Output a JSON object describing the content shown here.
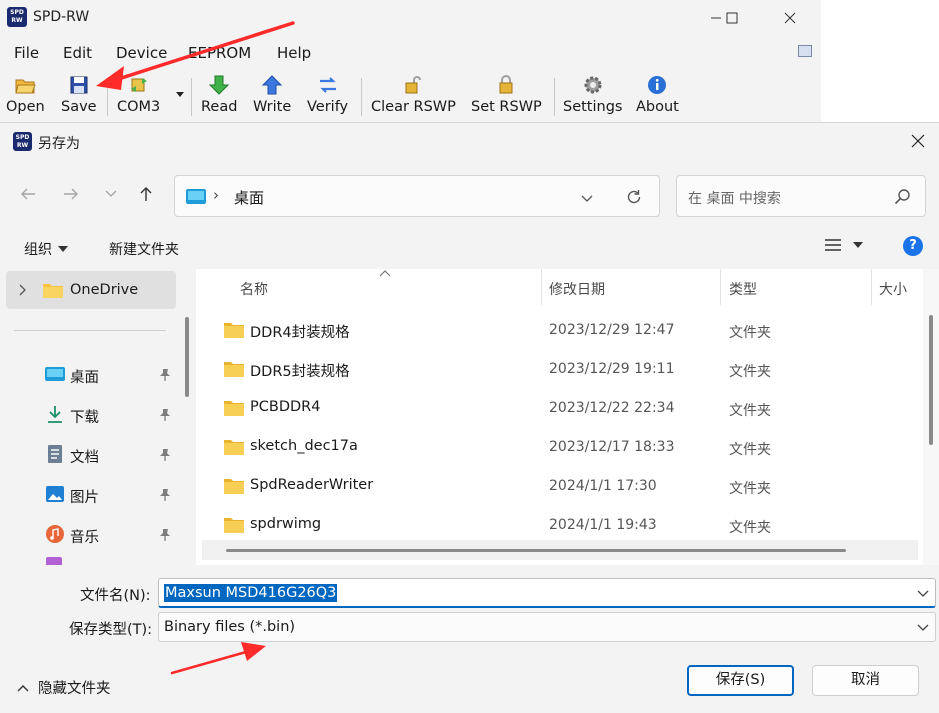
{
  "app": {
    "title": "SPD-RW",
    "logo_text": "SPD RW",
    "menu": [
      "File",
      "Edit",
      "Device",
      "EEPROM",
      "Help"
    ],
    "toolbar": {
      "open": "Open",
      "save": "Save",
      "port": "COM3",
      "read": "Read",
      "write": "Write",
      "verify": "Verify",
      "clear_rswp": "Clear RSWP",
      "set_rswp": "Set RSWP",
      "settings": "Settings",
      "about": "About"
    }
  },
  "dialog": {
    "title": "另存为",
    "address_sep": "›",
    "address": "桌面",
    "search_placeholder": "在 桌面 中搜索",
    "organize": "组织",
    "new_folder": "新建文件夹",
    "help_glyph": "?",
    "sidebar": {
      "onedrive": "OneDrive",
      "items": [
        {
          "label": "桌面",
          "icon": "desktop-icon"
        },
        {
          "label": "下载",
          "icon": "download-icon"
        },
        {
          "label": "文档",
          "icon": "document-icon"
        },
        {
          "label": "图片",
          "icon": "picture-icon"
        },
        {
          "label": "音乐",
          "icon": "music-icon"
        }
      ]
    },
    "columns": {
      "name": "名称",
      "modified": "修改日期",
      "type": "类型",
      "size": "大小"
    },
    "files": [
      {
        "name": "DDR4封装规格",
        "modified": "2023/12/29 12:47",
        "type": "文件夹"
      },
      {
        "name": "DDR5封装规格",
        "modified": "2023/12/29 19:11",
        "type": "文件夹"
      },
      {
        "name": "PCBDDR4",
        "modified": "2023/12/22 22:34",
        "type": "文件夹"
      },
      {
        "name": "sketch_dec17a",
        "modified": "2023/12/17 18:33",
        "type": "文件夹"
      },
      {
        "name": "SpdReaderWriter",
        "modified": "2024/1/1 17:30",
        "type": "文件夹"
      },
      {
        "name": "spdrwimg",
        "modified": "2024/1/1 19:43",
        "type": "文件夹"
      }
    ],
    "filename_label": "文件名(N):",
    "filename_value": "Maxsun MSD416G26Q3",
    "filetype_label": "保存类型(T):",
    "filetype_value": "Binary files (*.bin)",
    "hide_folders": "隐藏文件夹",
    "save_button": "保存(S)",
    "cancel_button": "取消"
  },
  "colors": {
    "accent": "#0067c0",
    "folder": "#f6c343",
    "arrow": "#ff2a2a"
  }
}
